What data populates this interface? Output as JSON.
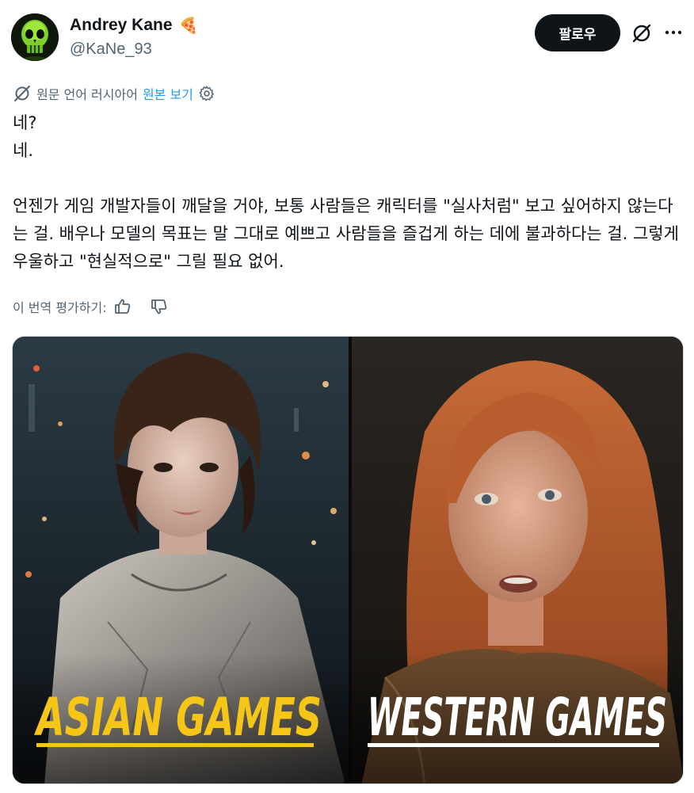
{
  "author": {
    "display_name": "Andrey Kane",
    "badge_emoji": "🍕",
    "handle": "@KaNe_93",
    "avatar_icon": "green-skull-avatar"
  },
  "actions": {
    "follow_label": "팔로우",
    "grok_icon": "grok-icon",
    "more_icon": "more-dots-icon"
  },
  "translation": {
    "icon": "grok-translate-icon",
    "source_text": "원문 언어 러시아어",
    "view_original": "원본 보기",
    "settings_icon": "gear-icon"
  },
  "body": {
    "line1": "네?",
    "line2": "네.",
    "paragraph": "언젠가 게임 개발자들이 깨달을 거야, 보통 사람들은 캐릭터를 \"실사처럼\" 보고 싶어하지 않는다는 걸. 배우나 모델의 목표는 말 그대로 예쁘고 사람들을 즐겁게 하는 데에 불과하다는 걸. 그렇게 우울하고 \"현실적으로\" 그릴 필요 없어."
  },
  "rating": {
    "label": "이 번역 평가하기:",
    "thumbs_up_icon": "thumbs-up-icon",
    "thumbs_down_icon": "thumbs-down-icon"
  },
  "media": {
    "left_caption": "ASIAN GAMES",
    "right_caption": "WESTERN GAMES",
    "left_caption_color": "#f5c518",
    "right_caption_color": "#ffffff"
  },
  "colors": {
    "text_primary": "#0f1419",
    "text_secondary": "#536471",
    "link": "#1d9bf0",
    "follow_bg": "#0f1419"
  }
}
